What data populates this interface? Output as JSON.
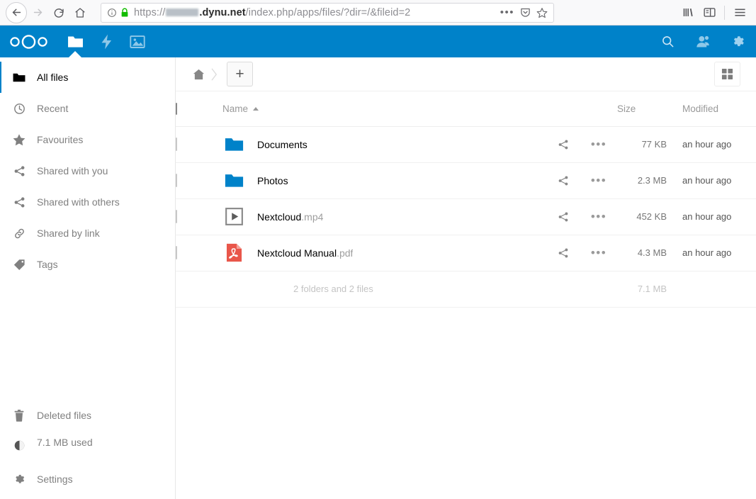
{
  "browser": {
    "back_label": "Back",
    "forward_label": "Forward",
    "reload_label": "Reload",
    "home_label": "Home",
    "url_prefix": "https://",
    "url_redacted_subdomain": "",
    "url_host": ".dynu.net",
    "url_path": "/index.php/apps/files/?dir=/&fileid=2",
    "page_actions_label": "Page actions",
    "pocket_label": "Save to Pocket",
    "bookmark_label": "Bookmark this page",
    "library_label": "Library",
    "sidebars_label": "Sidebars",
    "menu_label": "Open menu"
  },
  "nc_header": {
    "logo_label": "Nextcloud",
    "accent_color": "#0082c9",
    "apps": [
      {
        "name": "files",
        "label": "Files",
        "active": true
      },
      {
        "name": "activity",
        "label": "Activity",
        "active": false
      },
      {
        "name": "photos",
        "label": "Photos",
        "active": false
      }
    ],
    "right_actions": [
      {
        "name": "search",
        "label": "Search"
      },
      {
        "name": "contacts",
        "label": "Contacts"
      },
      {
        "name": "settings",
        "label": "Settings"
      }
    ]
  },
  "sidebar": {
    "items": [
      {
        "icon": "folder-icon",
        "label": "All files",
        "active": true
      },
      {
        "icon": "clock-icon",
        "label": "Recent",
        "active": false
      },
      {
        "icon": "star-icon",
        "label": "Favourites",
        "active": false
      },
      {
        "icon": "share-icon",
        "label": "Shared with you",
        "active": false
      },
      {
        "icon": "share-icon",
        "label": "Shared with others",
        "active": false
      },
      {
        "icon": "link-icon",
        "label": "Shared by link",
        "active": false
      },
      {
        "icon": "tag-icon",
        "label": "Tags",
        "active": false
      }
    ],
    "bottom": {
      "deleted_label": "Deleted files",
      "quota_label": "7.1 MB used",
      "quota_percent": 1,
      "settings_label": "Settings"
    }
  },
  "controls": {
    "home_label": "Home",
    "new_label": "+",
    "grid_toggle_label": "Toggle grid view"
  },
  "table": {
    "headers": {
      "select_all": "Select all",
      "name": "Name",
      "size": "Size",
      "modified": "Modified",
      "sort_direction": "ascending"
    },
    "rows": [
      {
        "icon": "folder-icon",
        "basename": "Documents",
        "ext": "",
        "size": "77 KB",
        "modified": "an hour ago",
        "share_label": "Share",
        "menu_label": "Actions"
      },
      {
        "icon": "folder-icon",
        "basename": "Photos",
        "ext": "",
        "size": "2.3 MB",
        "modified": "an hour ago",
        "share_label": "Share",
        "menu_label": "Actions"
      },
      {
        "icon": "video-icon",
        "basename": "Nextcloud",
        "ext": ".mp4",
        "size": "452 KB",
        "modified": "an hour ago",
        "share_label": "Share",
        "menu_label": "Actions"
      },
      {
        "icon": "pdf-icon",
        "basename": "Nextcloud Manual",
        "ext": ".pdf",
        "size": "4.3 MB",
        "modified": "an hour ago",
        "share_label": "Share",
        "menu_label": "Actions"
      }
    ],
    "summary": {
      "count_text": "2 folders and 2 files",
      "total_size": "7.1 MB"
    }
  }
}
